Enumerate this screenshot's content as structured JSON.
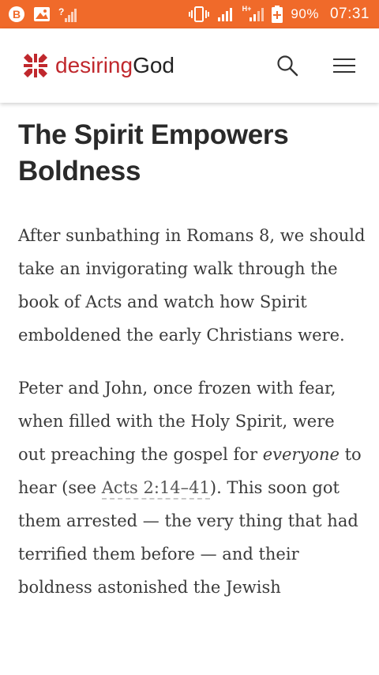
{
  "status_bar": {
    "network_type": "H+",
    "battery_percent": "90%",
    "time": "07:31",
    "bg_color": "#f06a2a"
  },
  "header": {
    "logo_part1": "desiring",
    "logo_part2": "God",
    "brand_color": "#c0282d"
  },
  "article": {
    "title_line1": "The Spirit Empowers",
    "title_line2": "Boldness",
    "p1": "After sunbathing in Romans 8, we should take an invigorating walk through the book of Acts and watch how Spirit emboldened the early Christians were.",
    "p2_a": "Peter and John, once frozen with fear, when filled with the Holy Spirit, were out preaching the gospel for ",
    "p2_em": "everyone",
    "p2_b": " to hear (see ",
    "p2_link": "Acts 2:14–41",
    "p2_c": "). This soon got them arrested — the very thing that had terrified them before — and their boldness astonished the Jewish"
  }
}
